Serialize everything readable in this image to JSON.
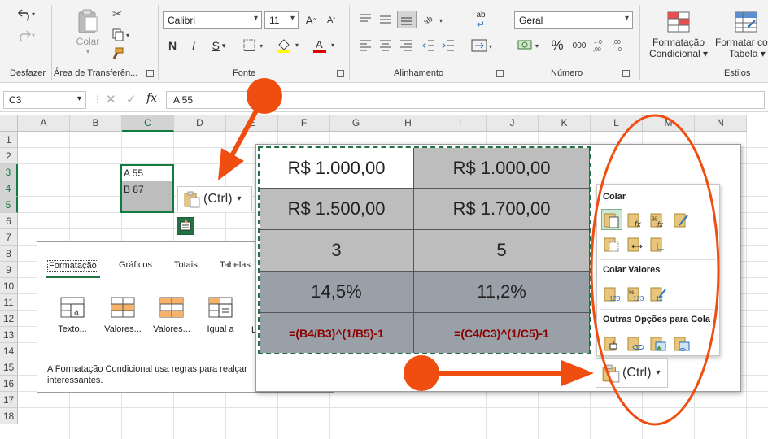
{
  "ribbon": {
    "undo_group": "Desfazer",
    "clipboard_group": "Área de Transferên...",
    "paste_label": "Colar",
    "font_group": "Fonte",
    "font_name": "Calibri",
    "font_size": "11",
    "bold": "N",
    "italic": "I",
    "underline": "S",
    "align_group": "Alinhamento",
    "wrap_label": "ab",
    "number_group": "Número",
    "number_format": "Geral",
    "percent": "%",
    "thousands": "000",
    "styles_group": "Estilos",
    "cond_format_label1": "Formatação",
    "cond_format_label2": "Condicional",
    "format_table_label1": "Formatar co",
    "format_table_label2": "Tabela"
  },
  "formula_bar": {
    "name_box": "C3",
    "fx": "fx",
    "content": "A 55"
  },
  "columns": [
    "A",
    "B",
    "C",
    "D",
    "E",
    "F",
    "G",
    "H",
    "I",
    "J",
    "K",
    "L",
    "M",
    "N"
  ],
  "rows": [
    "1",
    "2",
    "3",
    "4",
    "5",
    "6",
    "7",
    "8",
    "9",
    "10",
    "11",
    "12",
    "13",
    "14",
    "15",
    "16",
    "17",
    "18"
  ],
  "cells": {
    "c3": "A 55",
    "c4": "B 87"
  },
  "ctrl_label": "(Ctrl)",
  "quick_analysis": {
    "tabs": [
      "Formatação",
      "Gráficos",
      "Totais",
      "Tabelas"
    ],
    "tiles": [
      "Texto...",
      "Valores...",
      "Valores...",
      "Igual a"
    ],
    "tile_partial": "L",
    "description_line1": "A Formatação Condicional usa regras para realçar",
    "description_line2": "interessantes."
  },
  "pasted_table": {
    "rows": [
      [
        "R$ 1.000,00",
        "R$ 1.000,00"
      ],
      [
        "R$ 1.500,00",
        "R$ 1.700,00"
      ],
      [
        "3",
        "5"
      ],
      [
        "14,5%",
        "11,2%"
      ],
      [
        "=(B4/B3)^(1/B5)-1",
        "=(C4/C3)^(1/C5)-1"
      ]
    ]
  },
  "paste_menu": {
    "section1": "Colar",
    "section2": "Colar Valores",
    "section3": "Outras Opções para Cola"
  },
  "colors": {
    "accent_green": "#217346",
    "annotation_red": "#f04d11",
    "formula_text": "#8b0000",
    "selection_green": "#107c41"
  }
}
